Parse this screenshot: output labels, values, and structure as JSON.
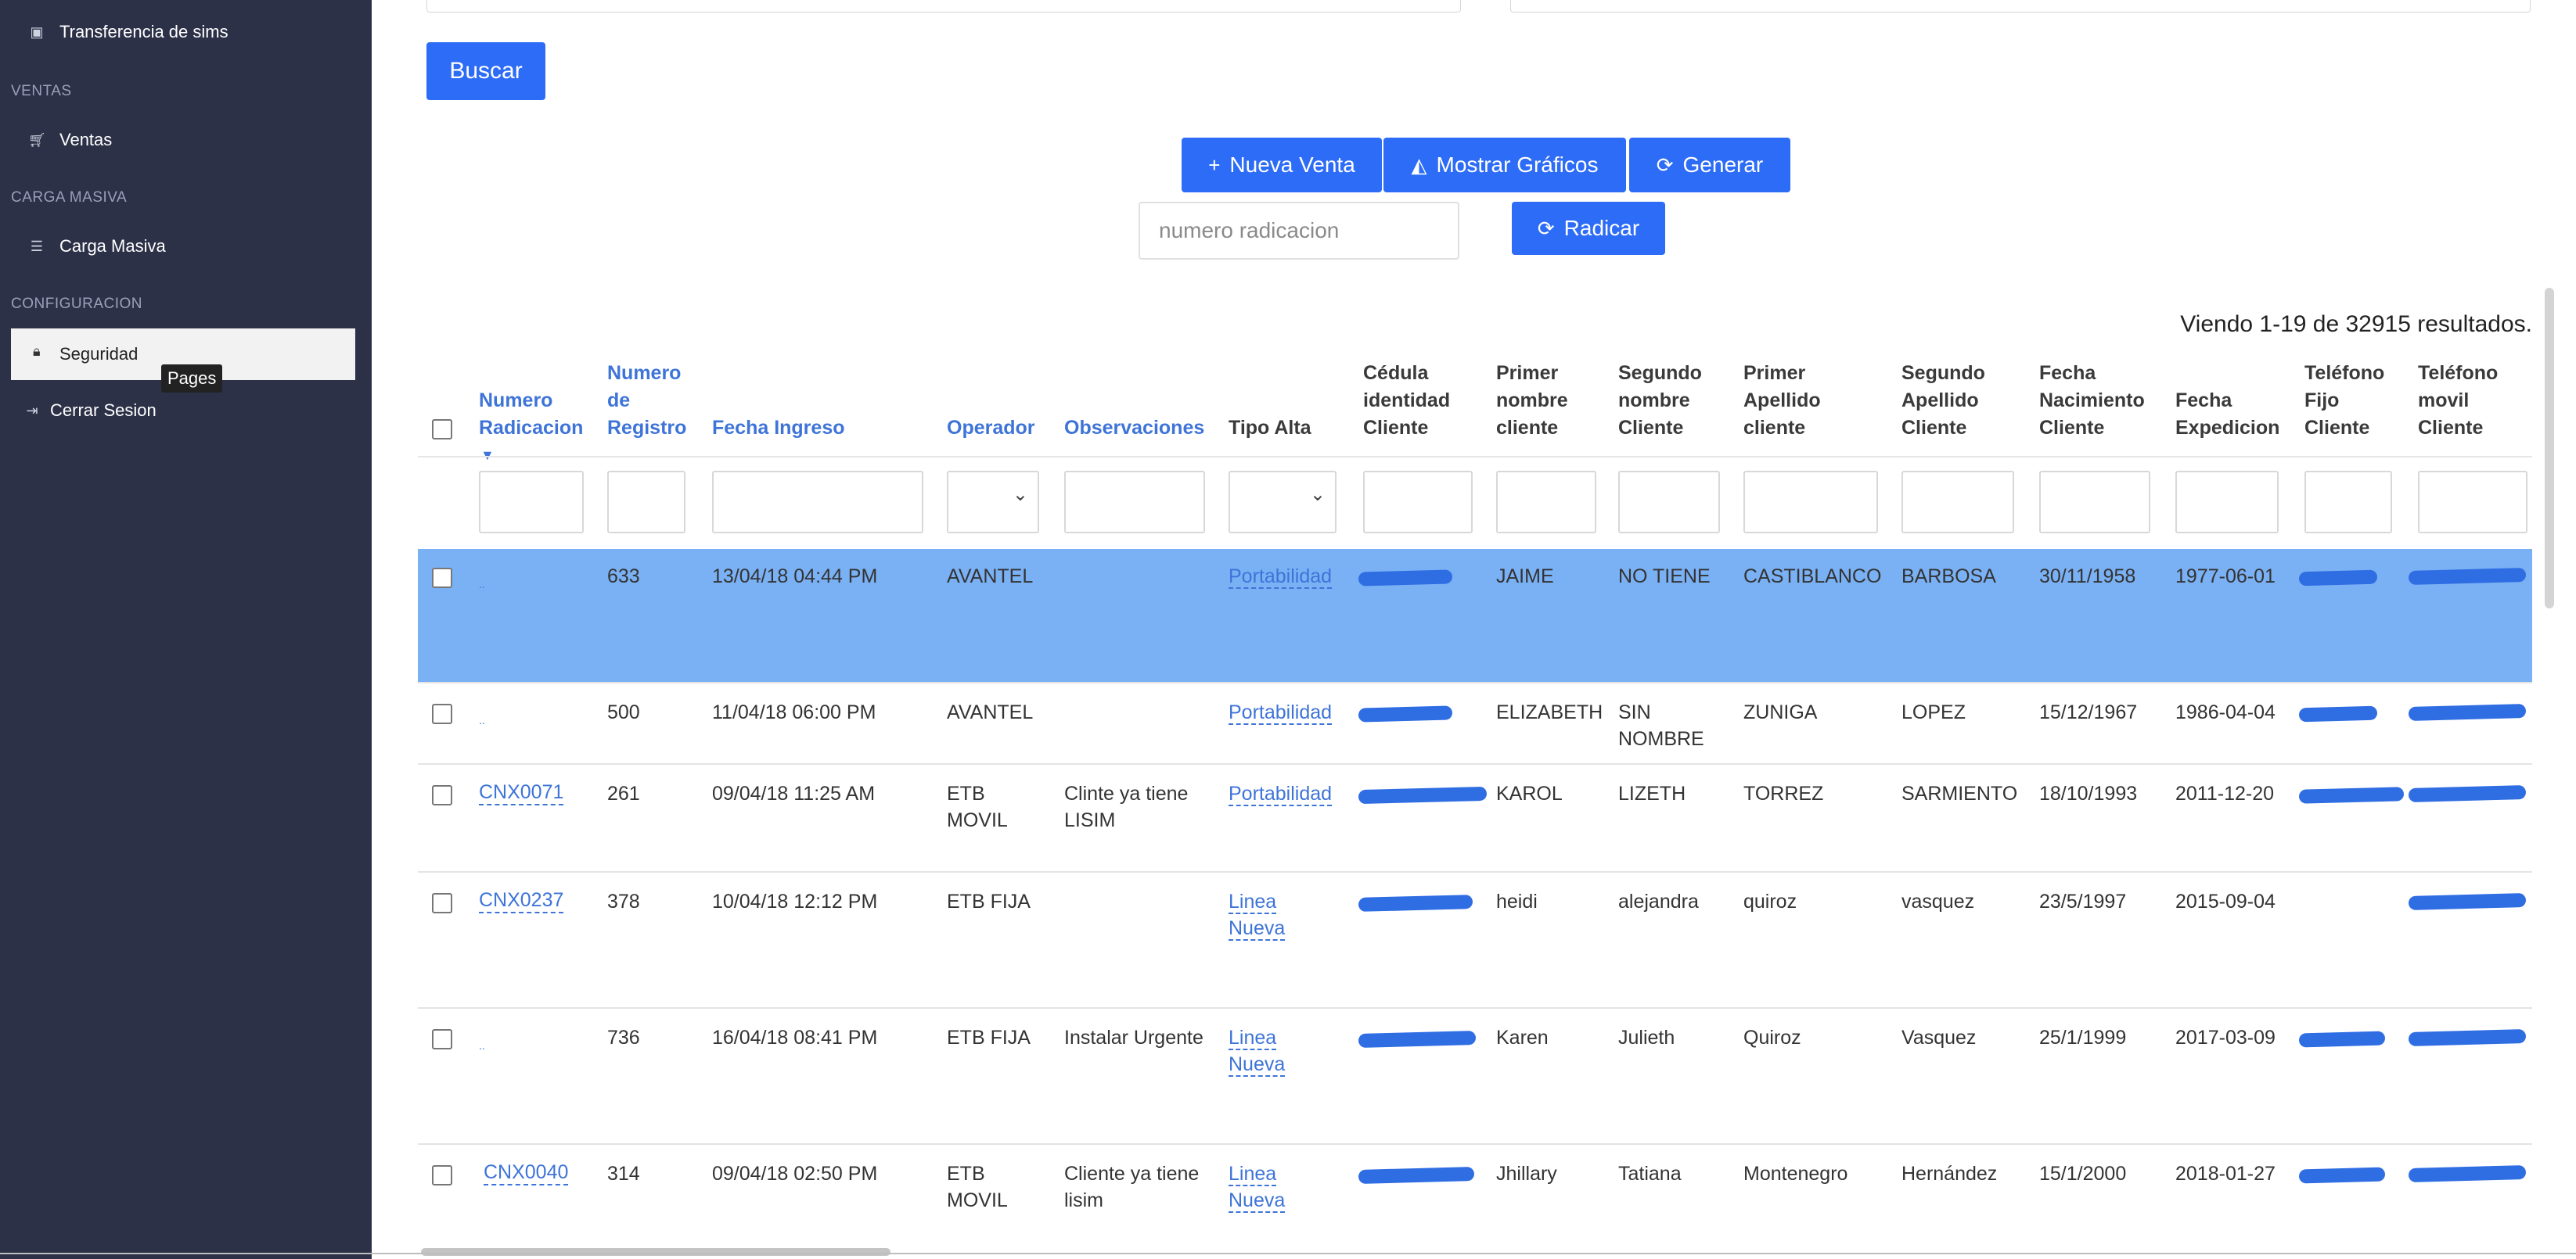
{
  "sidebar": {
    "transfer": "Transferencia de sims",
    "section_ventas": "VENTAS",
    "ventas": "Ventas",
    "section_carga": "CARGA MASIVA",
    "carga": "Carga Masiva",
    "section_config": "CONFIGURACION",
    "seguridad": "Seguridad",
    "tooltip": "Pages",
    "cerrar": "Cerrar Sesion"
  },
  "toolbar": {
    "buscar": "Buscar",
    "nueva_venta": "Nueva Venta",
    "mostrar_graficos": "Mostrar Gráficos",
    "generar": "Generar",
    "radicar": "Radicar",
    "radicacion_placeholder": "numero radicacion"
  },
  "results_text": "Viendo 1-19 de 32915 resultados.",
  "columns": [
    {
      "lines": [
        "Numero",
        "Radicacion"
      ],
      "sortable": true
    },
    {
      "lines": [
        "Numero",
        "de",
        "Registro"
      ],
      "sortable": true
    },
    {
      "lines": [
        "Fecha Ingreso"
      ],
      "sortable": true
    },
    {
      "lines": [
        "Operador"
      ],
      "sortable": true
    },
    {
      "lines": [
        "Observaciones"
      ],
      "sortable": true
    },
    {
      "lines": [
        "Tipo Alta"
      ],
      "sortable": false
    },
    {
      "lines": [
        "Cédula",
        "identidad",
        "Cliente"
      ],
      "sortable": false
    },
    {
      "lines": [
        "Primer",
        "nombre",
        "cliente"
      ],
      "sortable": false
    },
    {
      "lines": [
        "Segundo",
        "nombre",
        "Cliente"
      ],
      "sortable": false
    },
    {
      "lines": [
        "Primer",
        "Apellido",
        "cliente"
      ],
      "sortable": false
    },
    {
      "lines": [
        "Segundo",
        "Apellido",
        "Cliente"
      ],
      "sortable": false
    },
    {
      "lines": [
        "Fecha",
        "Nacimiento",
        "Cliente"
      ],
      "sortable": false
    },
    {
      "lines": [
        "Fecha",
        "Expedicion"
      ],
      "sortable": false
    },
    {
      "lines": [
        "Teléfono",
        "Fijo",
        "Cliente"
      ],
      "sortable": false
    },
    {
      "lines": [
        "Teléfono",
        "movil",
        "Cliente"
      ],
      "sortable": false
    }
  ],
  "rows": [
    {
      "radicacion": "..",
      "registro": "633",
      "fecha": "13/04/18 04:44 PM",
      "operador": "AVANTEL",
      "obs": "",
      "tipo": "Portabilidad",
      "n1": "JAIME",
      "n2": "NO TIENE",
      "a1": "CASTIBLANCO",
      "a2": "BARBOSA",
      "nac": "30/11/1958",
      "exp": "1977-06-01",
      "selected": true
    },
    {
      "radicacion": "..",
      "registro": "500",
      "fecha": "11/04/18 06:00 PM",
      "operador": "AVANTEL",
      "obs": "",
      "tipo": "Portabilidad",
      "n1": "ELIZABETH",
      "n2": "SIN NOMBRE",
      "a1": "ZUNIGA",
      "a2": "LOPEZ",
      "nac": "15/12/1967",
      "exp": "1986-04-04",
      "selected": false
    },
    {
      "radicacion": "CNX0071",
      "registro": "261",
      "fecha": "09/04/18 11:25 AM",
      "operador": "ETB MOVIL",
      "obs": "Clinte ya tiene LISIM",
      "tipo": "Portabilidad",
      "n1": "KAROL",
      "n2": "LIZETH",
      "a1": "TORREZ",
      "a2": "SARMIENTO",
      "nac": "18/10/1993",
      "exp": "2011-12-20",
      "selected": false
    },
    {
      "radicacion": "CNX0237",
      "registro": "378",
      "fecha": "10/04/18 12:12 PM",
      "operador": "ETB FIJA",
      "obs": "",
      "tipo": "Linea Nueva",
      "n1": "heidi",
      "n2": "alejandra",
      "a1": "quiroz",
      "a2": "vasquez",
      "nac": "23/5/1997",
      "exp": "2015-09-04",
      "selected": false
    },
    {
      "radicacion": "..",
      "registro": "736",
      "fecha": "16/04/18 08:41 PM",
      "operador": "ETB FIJA",
      "obs": "Instalar Urgente",
      "tipo": "Linea Nueva",
      "n1": "Karen",
      "n2": "Julieth",
      "a1": "Quiroz",
      "a2": "Vasquez",
      "nac": "25/1/1999",
      "exp": "2017-03-09",
      "selected": false
    },
    {
      "radicacion": "CNX0040",
      "registro": "314",
      "fecha": "09/04/18 02:50 PM",
      "operador": "ETB MOVIL",
      "obs": "Cliente ya tiene lisim",
      "tipo": "Linea Nueva",
      "n1": "Jhillary",
      "n2": "Tatiana",
      "a1": "Montenegro",
      "a2": "Hernández",
      "nac": "15/1/2000",
      "exp": "2018-01-27",
      "selected": false
    }
  ]
}
